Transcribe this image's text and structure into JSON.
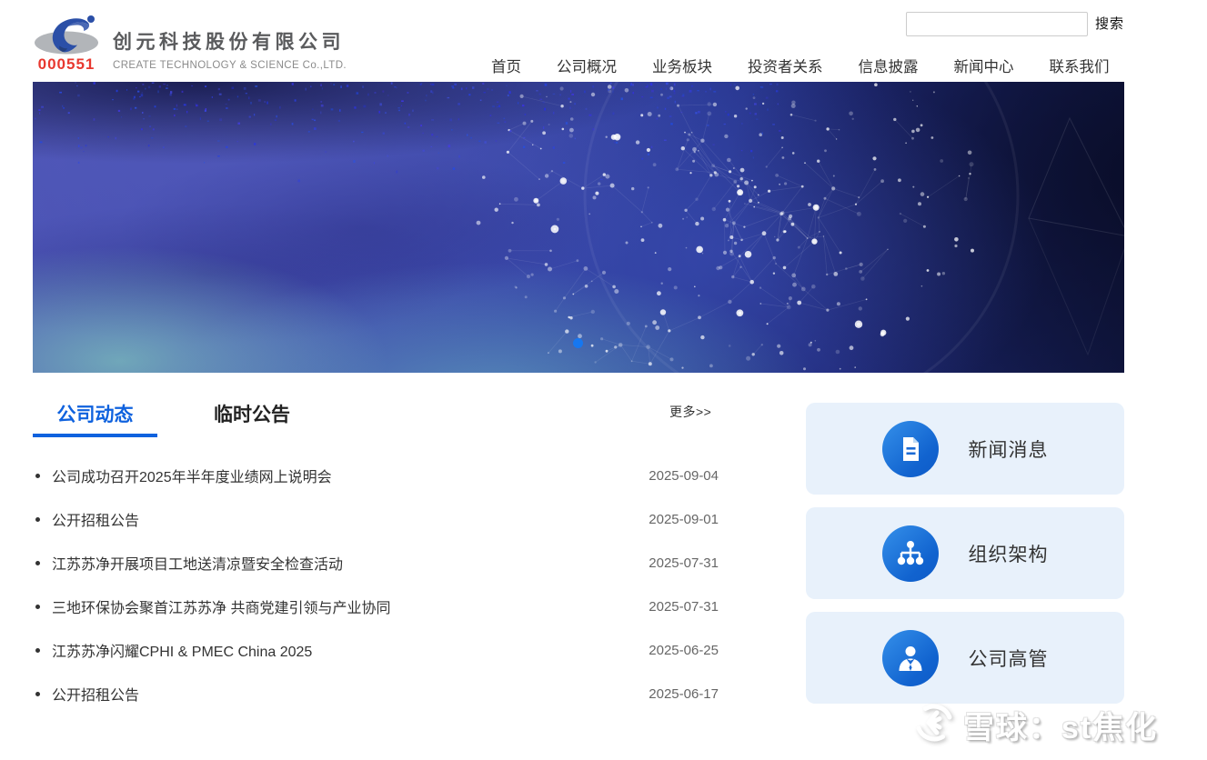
{
  "header": {
    "stock_code": "000551",
    "company_name": "创元科技股份有限公司",
    "company_name_en": "CREATE TECHNOLOGY & SCIENCE Co.,LTD.",
    "search": {
      "value": "",
      "button_label": "搜索"
    },
    "nav": [
      {
        "label": "首页"
      },
      {
        "label": "公司概况"
      },
      {
        "label": "业务板块"
      },
      {
        "label": "投资者关系"
      },
      {
        "label": "信息披露"
      },
      {
        "label": "新闻中心"
      },
      {
        "label": "联系我们"
      }
    ]
  },
  "banner": {
    "description": "abstract blue ink texture with particle network sphere",
    "carousel_dots": 1
  },
  "news_section": {
    "tabs": [
      {
        "label": "公司动态",
        "active": true
      },
      {
        "label": "临时公告",
        "active": false
      }
    ],
    "more_label": "更多>>",
    "items": [
      {
        "title": "公司成功召开2025年半年度业绩网上说明会",
        "date": "2025-09-04"
      },
      {
        "title": "公开招租公告",
        "date": "2025-09-01"
      },
      {
        "title": "江苏苏净开展项目工地送清凉暨安全检查活动",
        "date": "2025-07-31"
      },
      {
        "title": "三地环保协会聚首江苏苏净 共商党建引领与产业协同",
        "date": "2025-07-31"
      },
      {
        "title": "江苏苏净闪耀CPHI & PMEC China 2025",
        "date": "2025-06-25"
      },
      {
        "title": "公开招租公告",
        "date": "2025-06-17"
      }
    ]
  },
  "quick_links": [
    {
      "label": "新闻消息",
      "icon": "news-document-icon"
    },
    {
      "label": "组织架构",
      "icon": "org-chart-icon"
    },
    {
      "label": "公司高管",
      "icon": "executive-person-icon"
    }
  ],
  "watermark": {
    "text": "雪球：st焦化",
    "icon": "snowball-logo-icon"
  },
  "colors": {
    "accent_blue": "#0f62de",
    "icon_circle_blue": "#1163cf",
    "card_background": "#e8f1fb",
    "stock_code_red": "#e8382f",
    "carousel_dot_blue": "#1677f0"
  }
}
